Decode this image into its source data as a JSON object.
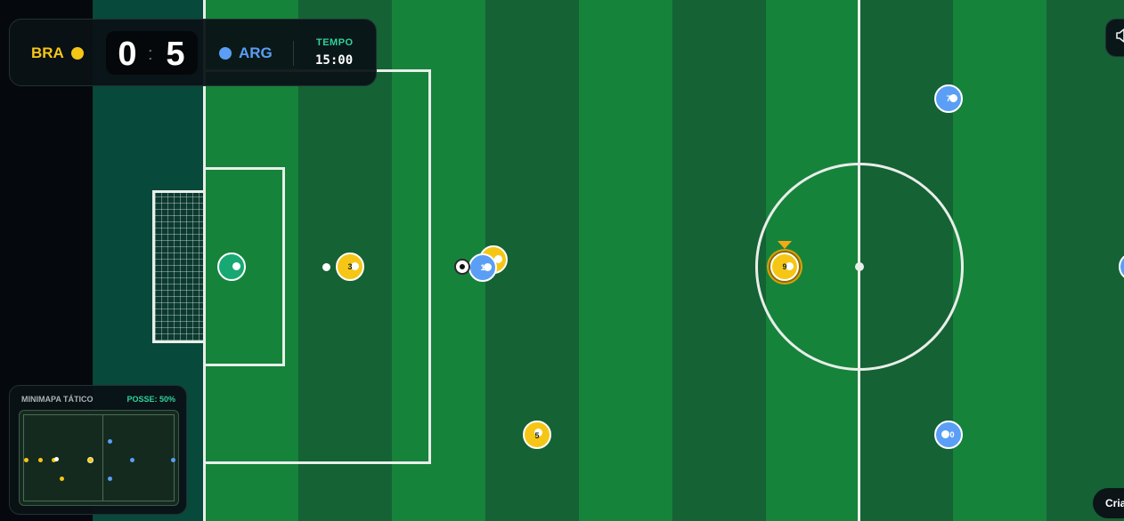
{
  "scoreboard": {
    "home_team": "BRA",
    "away_team": "ARG",
    "home_score": "0",
    "separator": ":",
    "away_score": "5",
    "time_label": "TEMPO",
    "time_value": "15:00"
  },
  "colors": {
    "home": "#f6c616",
    "away": "#5b9ef5",
    "goalkeeper": "#17a873",
    "accent": "#2ed39a",
    "field_light": "#16833b",
    "field_dark": "#156234"
  },
  "players": [
    {
      "team": "goalkeeper",
      "number": ""
    },
    {
      "team": "home",
      "number": "3"
    },
    {
      "team": "home",
      "number": ""
    },
    {
      "team": "away",
      "number": "1"
    },
    {
      "team": "home",
      "number": "9",
      "selected": true
    },
    {
      "team": "home",
      "number": "5"
    },
    {
      "team": "away",
      "number": "7"
    },
    {
      "team": "away",
      "number": "0"
    }
  ],
  "minimap": {
    "title": "MINIMAPA TÁTICO",
    "possession": "POSSE: 50%"
  },
  "controls": {
    "sound_icon": "speaker-icon",
    "create_button": "Cria"
  }
}
